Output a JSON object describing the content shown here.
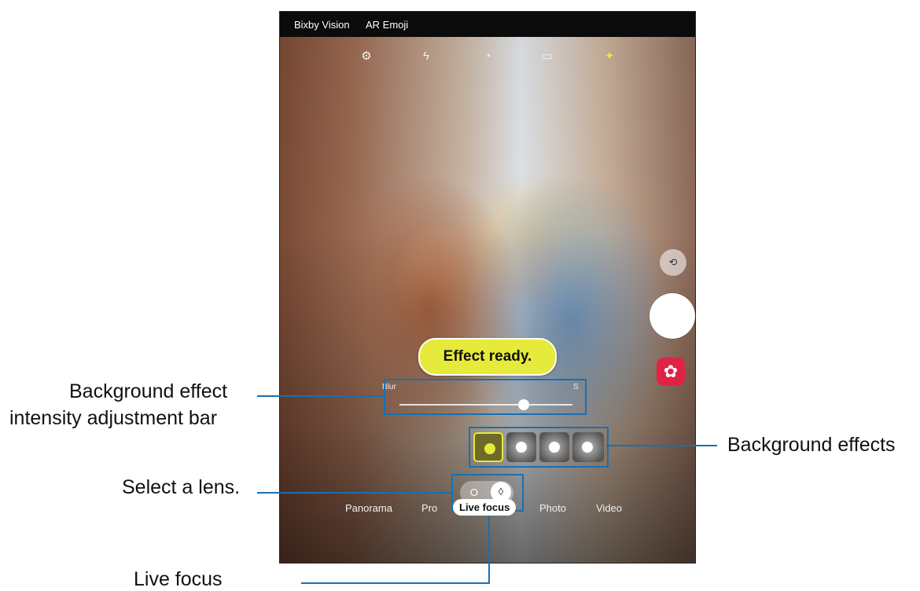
{
  "top_bar": {
    "bixby_vision": "Bixby Vision",
    "ar_emoji": "AR Emoji"
  },
  "quick_settings": [
    "settings-icon",
    "flash-off-icon",
    "timer-off-icon",
    "aspect-ratio-icon",
    "filters-icon"
  ],
  "effect_status": "Effect ready.",
  "intensity_slider": {
    "label_left": "Blur",
    "label_right": "S",
    "value": 0.72
  },
  "background_effects": [
    "blur",
    "spin",
    "zoom",
    "color-point"
  ],
  "selected_effect_index": 0,
  "lens_options": [
    "lens-small-icon",
    "lens-large-icon"
  ],
  "modes": [
    "Panorama",
    "Pro",
    "Live focus",
    "Photo",
    "Video"
  ],
  "active_mode": "Live focus",
  "callouts": {
    "intensity_line1": "Background effect",
    "intensity_line2": "intensity adjustment bar",
    "lens": "Select a lens.",
    "live_focus": "Live focus",
    "effects": "Background effects"
  },
  "colors": {
    "accent_yellow": "#e6ea3a",
    "callout_line": "#1a6fb0",
    "bixby_red": "#e02244"
  }
}
